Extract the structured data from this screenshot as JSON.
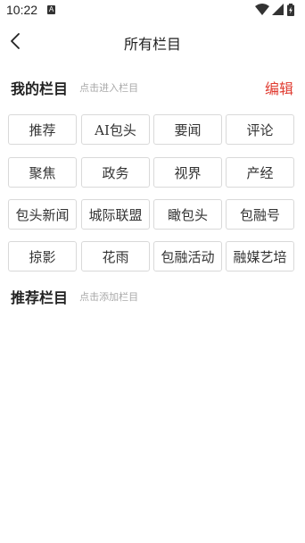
{
  "status_bar": {
    "time": "10:22",
    "notification_icon": "a-notification-icon",
    "a_glyph": "A",
    "icons": [
      "wifi-icon",
      "cellular-signal-icon",
      "battery-charging-icon"
    ]
  },
  "nav": {
    "back_icon": "chevron-left-icon",
    "title": "所有栏目"
  },
  "my_channels": {
    "title": "我的栏目",
    "hint": "点击进入栏目",
    "edit_label": "编辑",
    "items": [
      "推荐",
      "AI包头",
      "要闻",
      "评论",
      "聚焦",
      "政务",
      "视界",
      "产经",
      "包头新闻",
      "城际联盟",
      "瞰包头",
      "包融号",
      "掠影",
      "花雨",
      "包融活动",
      "融媒艺培"
    ]
  },
  "recommended_channels": {
    "title": "推荐栏目",
    "hint": "点击添加栏目"
  },
  "colors": {
    "accent": "#e03c31",
    "chip_border": "#d9d9d9",
    "hint_text": "#a9a9a9"
  }
}
